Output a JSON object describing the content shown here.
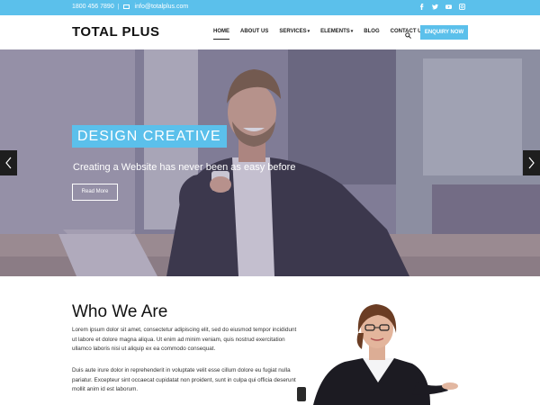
{
  "topbar": {
    "phone": "1800 456 7890",
    "separator": "|",
    "email": "info@totalplus.com",
    "social_icons": [
      "facebook-icon",
      "twitter-icon",
      "youtube-icon",
      "instagram-icon"
    ]
  },
  "header": {
    "logo": "TOTAL PLUS",
    "nav": [
      {
        "label": "HOME",
        "active": true
      },
      {
        "label": "ABOUT US"
      },
      {
        "label": "SERVICES",
        "dropdown": true
      },
      {
        "label": "ELEMENTS",
        "dropdown": true
      },
      {
        "label": "BLOG"
      },
      {
        "label": "CONTACT US"
      }
    ],
    "enquiry_label": "ENQUIRY NOW"
  },
  "hero": {
    "title": "DESIGN CREATIVE",
    "subtitle": "Creating a Website has never been as easy before",
    "button_label": "Read More"
  },
  "about": {
    "title": "Who We Are",
    "paragraph1": "Lorem ipsum dolor sit amet, consectetur adipiscing elit, sed do eiusmod tempor incididunt ut labore et dolore magna aliqua. Ut enim ad minim veniam, quis nostrud exercitation ullamco laboris nisi ut aliquip ex ea commodo consequat.",
    "paragraph2": "Duis aute irure dolor in reprehenderit in voluptate velit esse cillum dolore eu fugiat nulla pariatur. Excepteur sint occaecat cupidatat non proident, sunt in culpa qui officia deserunt mollit anim id est laborum."
  },
  "colors": {
    "accent": "#5bc0eb",
    "dark": "#111111"
  }
}
